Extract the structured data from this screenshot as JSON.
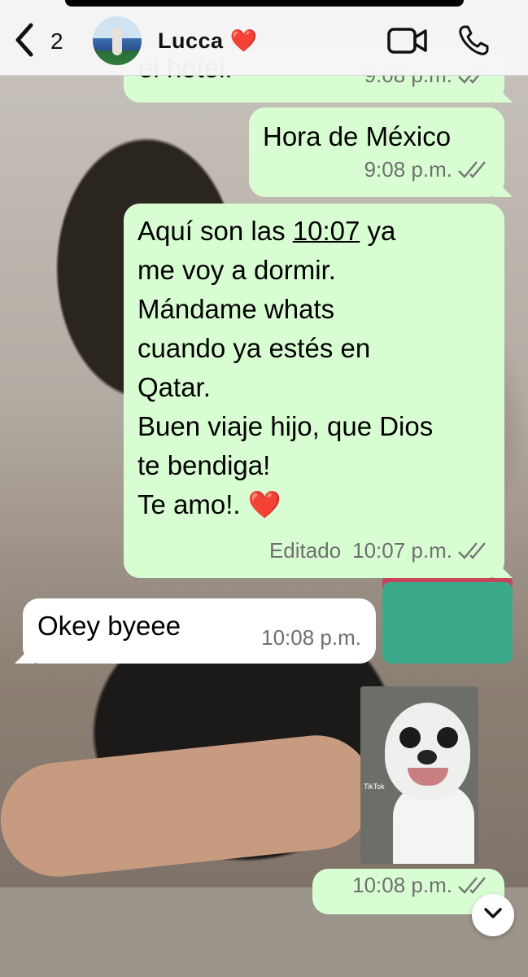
{
  "header": {
    "back_count": "2",
    "contact_name": "Lucca",
    "contact_emoji": "❤️"
  },
  "messages": [
    {
      "direction": "out",
      "text": "el hotel.",
      "time": "9:08 p.m.",
      "status": "read"
    },
    {
      "direction": "out",
      "text": "Hora de México",
      "time": "9:08 p.m.",
      "status": "read"
    },
    {
      "direction": "out",
      "text_before": "Aquí son las ",
      "text_link": "10:07",
      "text_after": " ya\nme voy a dormir.\nMándame whats\ncuando ya estés en\nQatar.\nBuen viaje hijo, que Dios\nte bendiga!\nTe amo!. ",
      "emoji": "❤️",
      "edited_label": "Editado",
      "time": "10:07 p.m.",
      "status": "read"
    },
    {
      "direction": "in",
      "text": "Okey byeee",
      "time": "10:08 p.m."
    },
    {
      "direction": "out",
      "type": "video",
      "thumb_label": "TikTok",
      "time": "10:08 p.m.",
      "status": "read"
    }
  ],
  "icons": {
    "back": "chevron-left-icon",
    "video_call": "video-camera-icon",
    "voice_call": "phone-icon",
    "read_receipt": "double-check-icon",
    "scroll": "chevron-down-icon"
  },
  "colors": {
    "outgoing_bubble": "#d9fdd3",
    "incoming_bubble": "#ffffff",
    "header_bg": "#f6f6f6"
  }
}
